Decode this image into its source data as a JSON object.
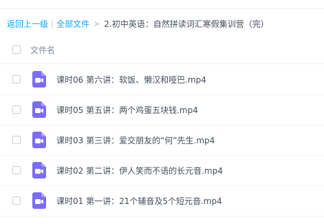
{
  "breadcrumb": {
    "back_label": "返回上一级",
    "all_files_label": "全部文件",
    "separator": "|",
    "arrow": ">",
    "current_folder": "2.初中英语：自然拼读词汇寒假集训营（完）"
  },
  "file_list": {
    "column_header": "文件名",
    "icon": "video-file-icon",
    "icon_color": "#7b6cf6",
    "items": [
      {
        "name": "课时06 第六讲：软饭、懒汉和哑巴.mp4"
      },
      {
        "name": "课时05 第五讲：两个鸡蛋五块钱.mp4"
      },
      {
        "name": "课时03 第三讲：爱交朋友的“何”先生.mp4"
      },
      {
        "name": "课时02 第二讲：伊人笑而不语的长元音.mp4"
      },
      {
        "name": "课时01 第一讲：21个辅音及5个短元音.mp4"
      }
    ]
  },
  "colors": {
    "link": "#06a7ff",
    "text": "#454d5a",
    "muted": "#818999"
  }
}
